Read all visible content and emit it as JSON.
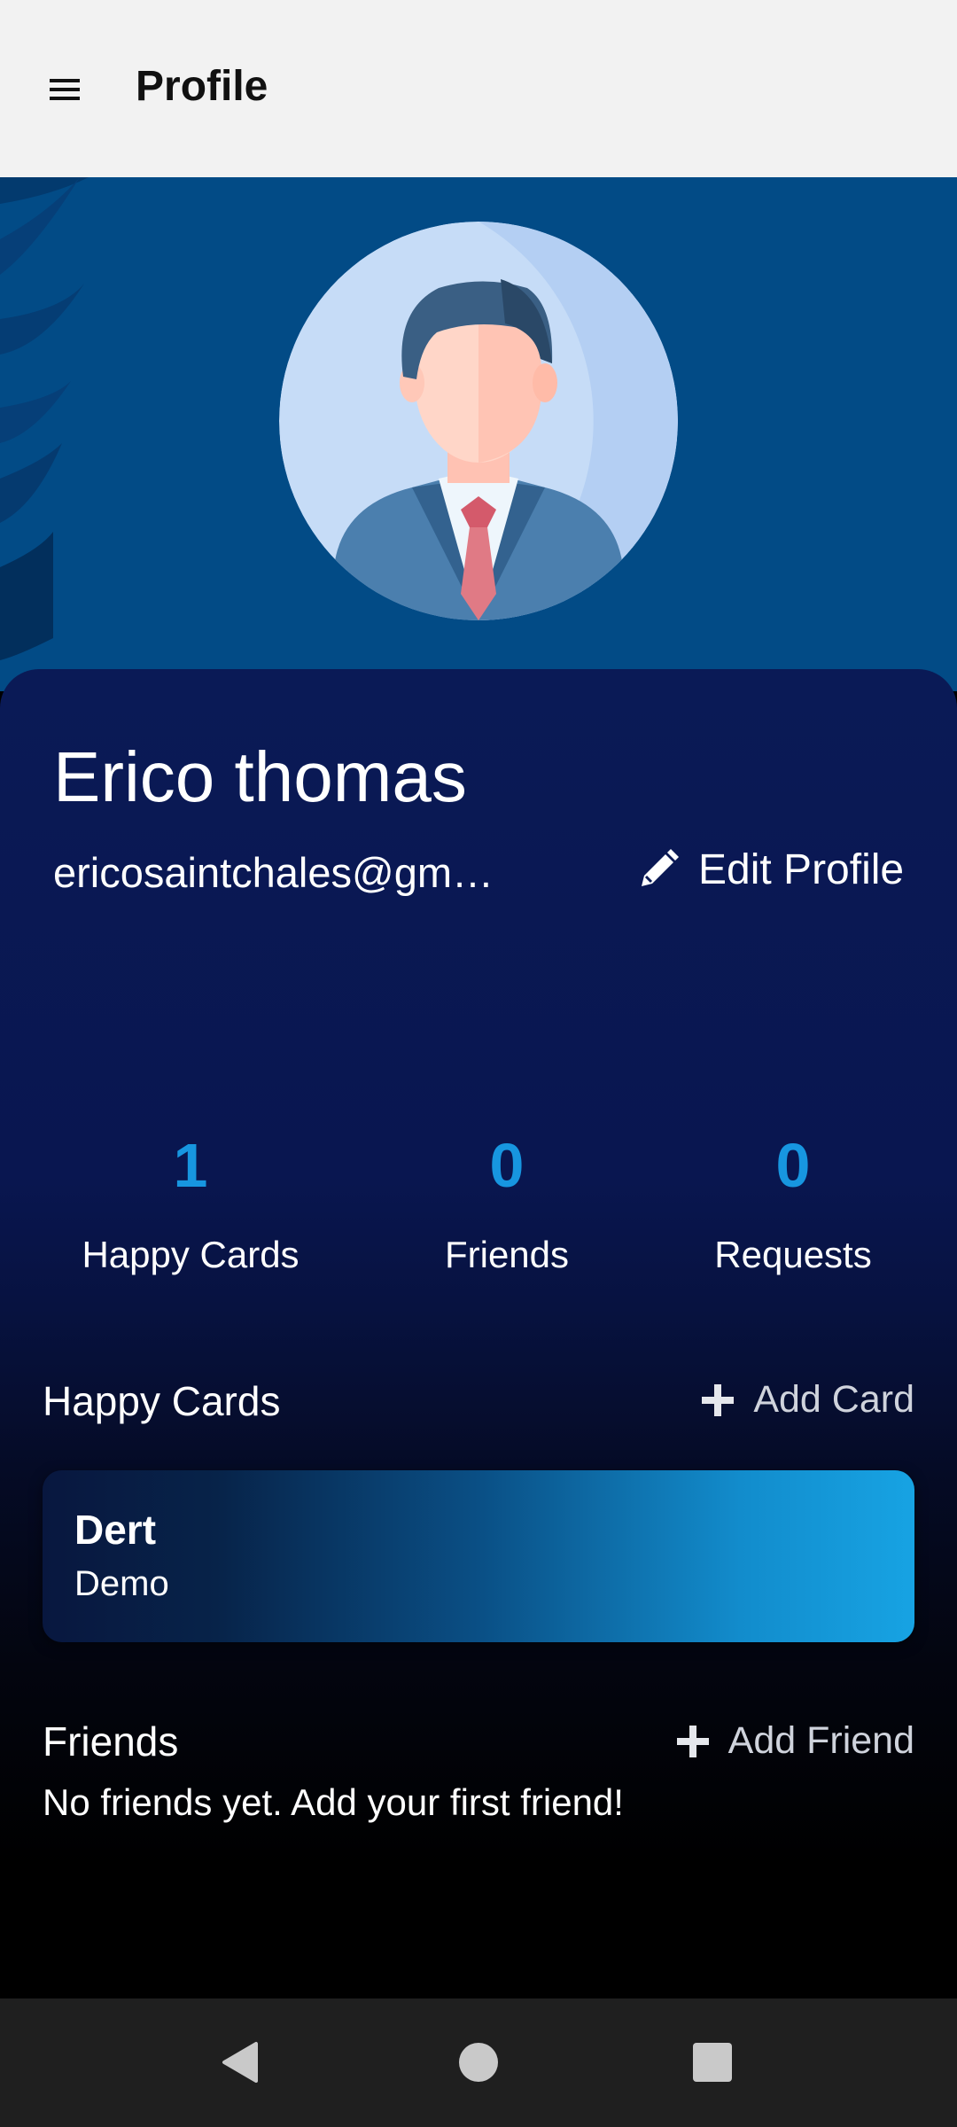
{
  "appbar": {
    "title": "Profile",
    "menu_icon": "hamburger-menu-icon"
  },
  "profile": {
    "name": "Erico thomas",
    "email": "ericosaintchales@gm…",
    "edit_label": "Edit Profile",
    "edit_icon": "pencil-icon",
    "avatar": "businessman-avatar"
  },
  "stats": [
    {
      "value": "1",
      "label": "Happy Cards"
    },
    {
      "value": "0",
      "label": "Friends"
    },
    {
      "value": "0",
      "label": "Requests"
    }
  ],
  "happy_cards": {
    "title": "Happy Cards",
    "add_label": "Add Card",
    "items": [
      {
        "title": "Dert",
        "subtitle": "Demo"
      }
    ]
  },
  "friends": {
    "title": "Friends",
    "add_label": "Add Friend",
    "empty_message": "No friends yet. Add your first friend!"
  },
  "navbar": {
    "back_icon": "back-triangle-icon",
    "home_icon": "home-circle-icon",
    "recents_icon": "recents-square-icon"
  },
  "colors": {
    "accent": "#1796e0",
    "hero_bg": "#024b86",
    "panel_bg": "#0a1a56",
    "appbar_bg": "#f2f2f2"
  }
}
